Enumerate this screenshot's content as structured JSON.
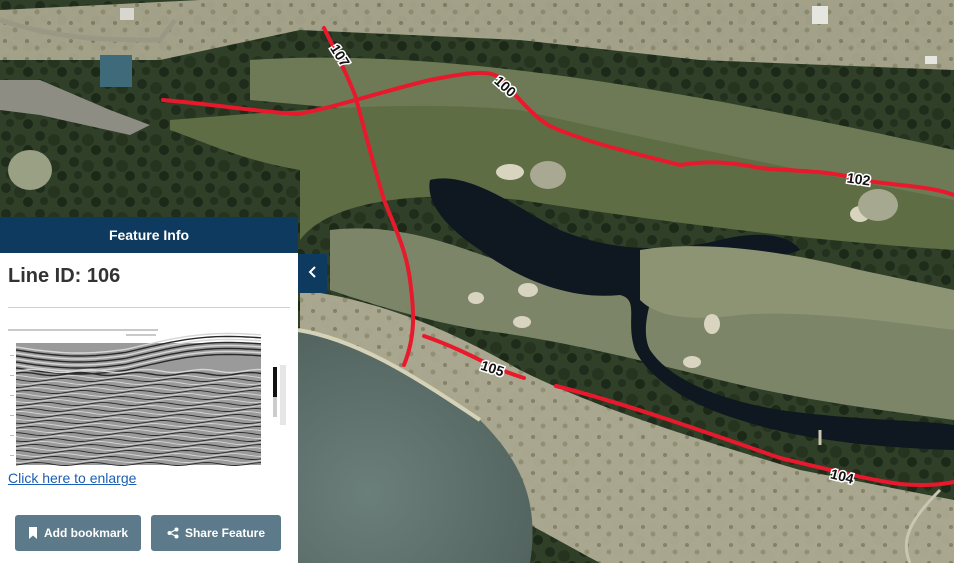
{
  "map": {
    "lines": [
      {
        "id": "107",
        "label": "107"
      },
      {
        "id": "100",
        "label": "100"
      },
      {
        "id": "102",
        "label": "102"
      },
      {
        "id": "105",
        "label": "105"
      },
      {
        "id": "104",
        "label": "104"
      }
    ],
    "line_color": "#e8192c"
  },
  "panel": {
    "header": "Feature Info",
    "title": "Line ID: 106",
    "enlarge_link": "Click here to enlarge",
    "bookmark_button": "Add bookmark",
    "share_button": "Share Feature",
    "collapse_icon": "chevron-left-icon",
    "header_color": "#0f3a5f",
    "button_color": "#5d7a8a"
  }
}
